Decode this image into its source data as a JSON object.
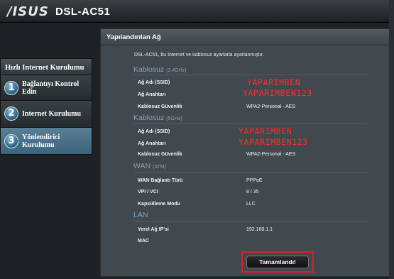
{
  "header": {
    "brand": "/ISUS",
    "model": "DSL-AC51"
  },
  "sidebar": {
    "title": "Hızlı Internet Kurulumu",
    "items": [
      {
        "number": "1",
        "label_line1": "Bağlantıyı Kontrol",
        "label_line2": "Edin",
        "active": false
      },
      {
        "number": "2",
        "label_line1": "Internet Kurulumu",
        "label_line2": "",
        "active": false
      },
      {
        "number": "3",
        "label_line1": "Yönlendirici",
        "label_line2": "Kurulumu",
        "active": true
      }
    ]
  },
  "panel": {
    "title": "Yapılandırılan Ağ",
    "intro": "DSL-AC51, bu Internet ve kablosuz ayarlarla ayarlanmıştır.",
    "wifi24": {
      "section": "Kablosuz",
      "band": "(2.4GHz)",
      "ssid_label": "Ağ Adı (SSID)",
      "key_label": "Ağ Anahtarı",
      "security_label": "Kablosuz Güvenlik",
      "security_value": "WPA2-Personal - AES",
      "ssid_overlay": "YAPARIMBEN",
      "key_overlay": "YAPARIMBEN123"
    },
    "wifi5": {
      "section": "Kablosuz",
      "band": "(5GHz)",
      "ssid_label": "Ağ Adı (SSID)",
      "key_label": "Ağ Anahtarı",
      "security_label": "Kablosuz Güvenlik",
      "security_value": "WPA2-Personal - AES",
      "ssid_overlay": "YAPARIMBEN",
      "key_overlay": "YAPARIMBEN123"
    },
    "wan": {
      "section": "WAN",
      "sub": "(ATM)",
      "type_label": "WAN Bağlantı Türü",
      "type_value": "PPPoE",
      "vpivci_label": "VPI / VCI",
      "vpivci_value": "8 / 35",
      "encap_label": "Kapsülleme Modu",
      "encap_value": "LLC"
    },
    "lan": {
      "section": "LAN",
      "ip_label": "Yerel Ağ IP'si",
      "ip_value": "192.168.1.1",
      "mac_label": "MAC"
    },
    "finish_button": "Tamamlandı!"
  }
}
